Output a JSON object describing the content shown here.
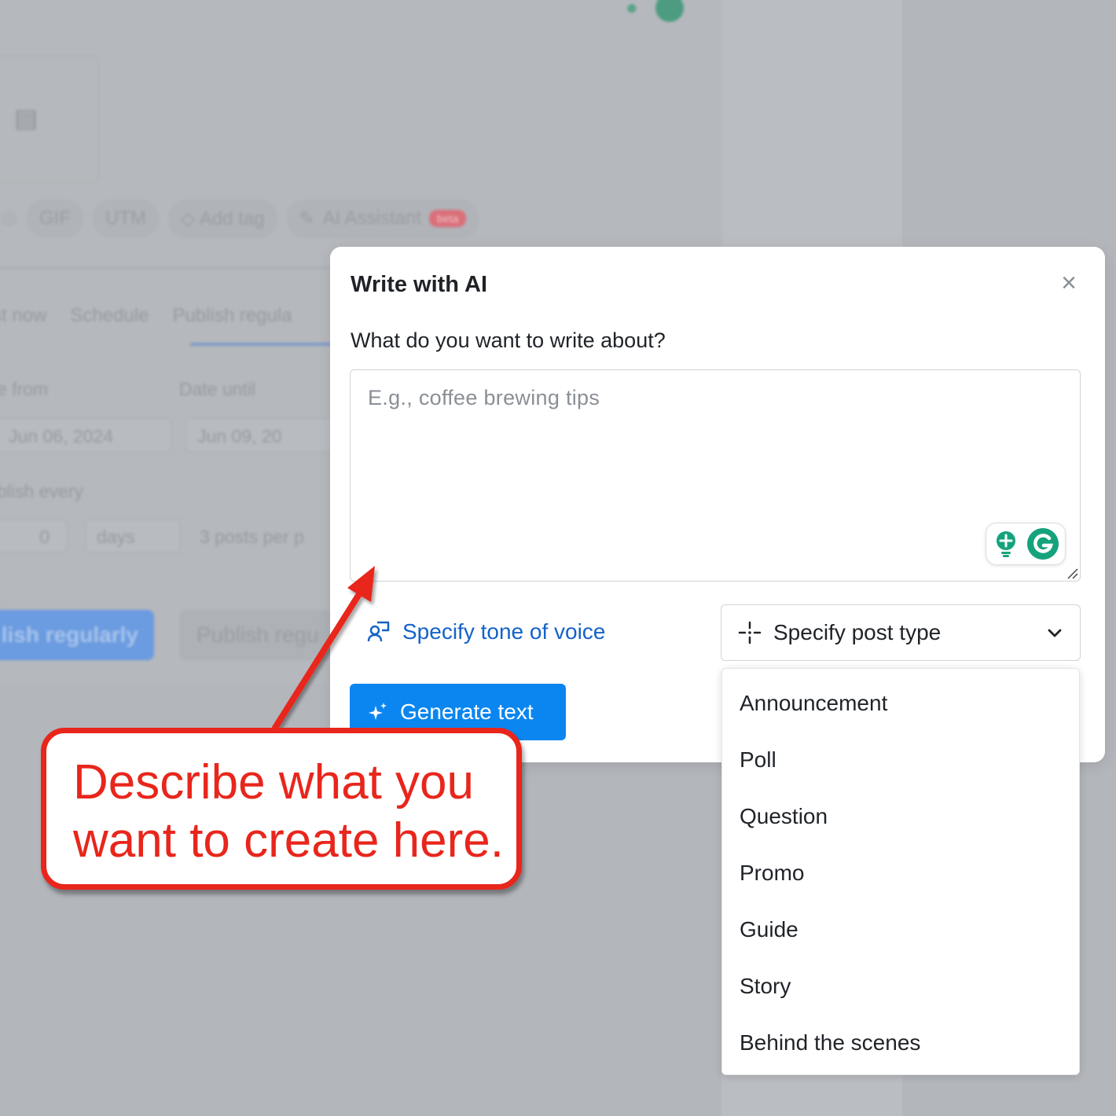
{
  "background": {
    "toolbar": [
      "GIF",
      "UTM",
      "Add tag",
      "AI Assistant"
    ],
    "ai_badge": "beta",
    "tabs": [
      "st now",
      "Schedule",
      "Publish regula"
    ],
    "date_from_label": "e from",
    "date_until_label": "Date until",
    "date_from_value": "Jun 06, 2024",
    "date_until_value": "Jun 09, 20",
    "publish_every_label": "blish every",
    "interval_value": "0",
    "interval_unit": "days",
    "posts_per": "3 posts per p",
    "primary_button": "lish regularly",
    "secondary_button": "Publish regu"
  },
  "modal": {
    "title": "Write with AI",
    "close_label": "×",
    "prompt_label": "What do you want to write about?",
    "prompt_placeholder": "E.g., coffee brewing tips",
    "tone_link": "Specify tone of voice",
    "post_type_placeholder": "Specify post type",
    "generate_button": "Generate text"
  },
  "post_type_options": [
    "Announcement",
    "Poll",
    "Question",
    "Promo",
    "Guide",
    "Story",
    "Behind the scenes"
  ],
  "annotation": {
    "text": "Describe what you want to create here."
  },
  "icons": {
    "close": "close-icon",
    "tone": "tone-of-voice-icon",
    "post_type": "sparkle-cross-icon",
    "chevron": "chevron-down-icon",
    "generate": "sparkles-icon",
    "grammarly": "grammarly-icon"
  },
  "colors": {
    "accent": "#0b86f0",
    "link": "#1463c8",
    "annotation": "#e8261c",
    "overlay": "#b3b6bb"
  }
}
